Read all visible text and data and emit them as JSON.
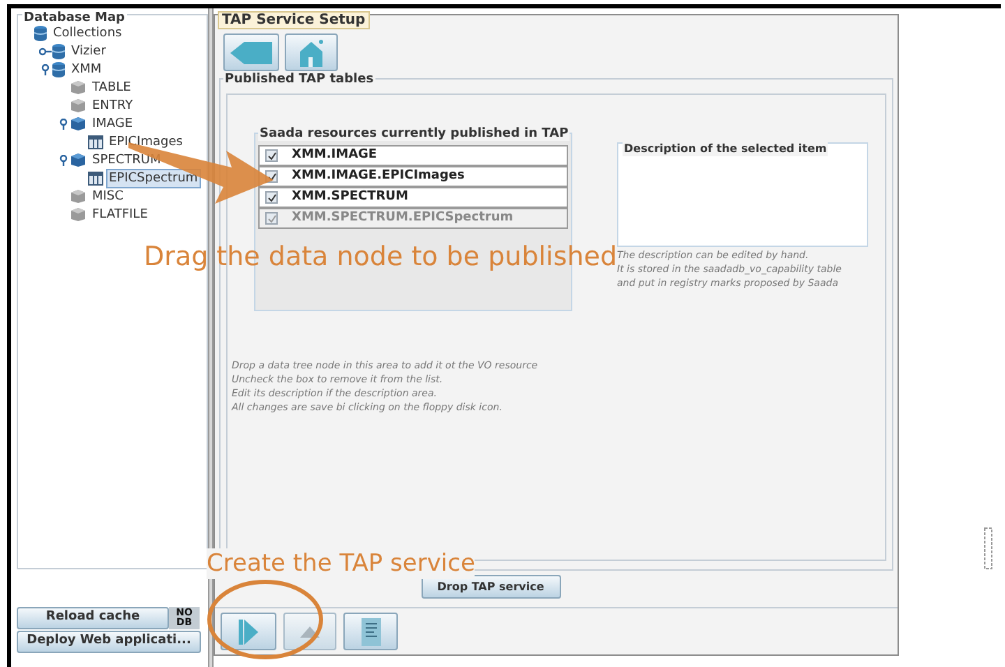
{
  "tree": {
    "title": "Database Map",
    "items": [
      {
        "label": "Collections",
        "kind": "database",
        "selected": false,
        "children": [
          {
            "label": "Vizier",
            "kind": "database",
            "selected": false,
            "expanded": false
          },
          {
            "label": "XMM",
            "kind": "database",
            "selected": false,
            "expanded": true,
            "children": [
              {
                "label": "TABLE",
                "kind": "category",
                "selected": false
              },
              {
                "label": "ENTRY",
                "kind": "category",
                "selected": false
              },
              {
                "label": "IMAGE",
                "kind": "category_active",
                "selected": false,
                "expanded": true,
                "children": [
                  {
                    "label": "EPICImages",
                    "kind": "table",
                    "selected": false
                  }
                ]
              },
              {
                "label": "SPECTRUM",
                "kind": "category_active",
                "selected": false,
                "expanded": true,
                "children": [
                  {
                    "label": "EPICSpectrum",
                    "kind": "table",
                    "selected": true
                  }
                ]
              },
              {
                "label": "MISC",
                "kind": "category",
                "selected": false
              },
              {
                "label": "FLATFILE",
                "kind": "category",
                "selected": false
              }
            ]
          }
        ]
      }
    ]
  },
  "left_buttons": {
    "reload": "Reload cache",
    "db_badge": [
      "NO",
      "DB"
    ],
    "deploy": "Deploy Web applicati..."
  },
  "panel": {
    "title": "TAP Service Setup",
    "group_title": "Published TAP tables",
    "resources": {
      "title": "Saada resources currently published in TAP",
      "items": [
        {
          "label": "XMM.IMAGE",
          "checked": true,
          "disabled": false
        },
        {
          "label": "XMM.IMAGE.EPICImages",
          "checked": true,
          "disabled": false
        },
        {
          "label": "XMM.SPECTRUM",
          "checked": true,
          "disabled": false
        },
        {
          "label": "XMM.SPECTRUM.EPICSpectrum",
          "checked": true,
          "disabled": true
        }
      ]
    },
    "description": {
      "title": "Description of the selected item",
      "hint": [
        "The description can be edited by hand.",
        "It is stored in the saadadb_vo_capability table",
        "and put in registry marks proposed by Saada"
      ]
    },
    "help": [
      "Drop a data tree node in this area to add it ot the VO resource",
      "Uncheck the box to remove it from the list.",
      "Edit its description if the description area.",
      "All changes are save bi clicking on the floppy disk icon."
    ],
    "drop_button": "Drop TAP service"
  },
  "annotations": [
    "Drag the data node to be published",
    "Create the TAP service"
  ]
}
